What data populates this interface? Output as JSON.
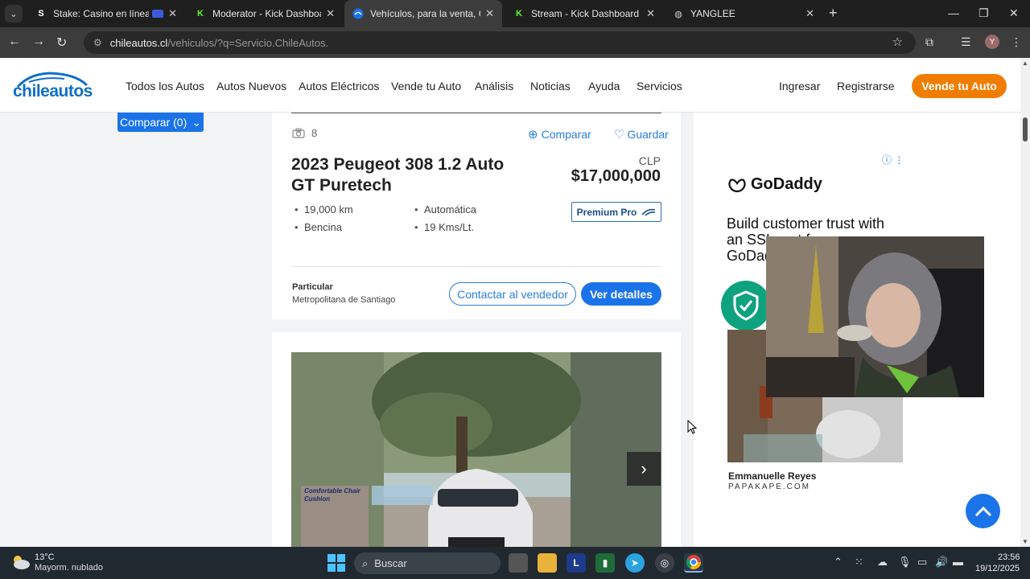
{
  "browser": {
    "tabs": [
      {
        "title": "Stake: Casino en línea y Ap",
        "favicon": "S"
      },
      {
        "title": "Moderator - Kick Dashboard",
        "favicon": "K"
      },
      {
        "title": "Vehículos, para la venta, Chile -",
        "favicon": "chileautos"
      },
      {
        "title": "Stream - Kick Dashboard",
        "favicon": "K"
      },
      {
        "title": "YANGLEE",
        "favicon": "globe"
      }
    ],
    "active_tab": 2,
    "url_host": "chileautos.cl",
    "url_path": "/vehiculos/?q=Servicio.ChileAutos.",
    "profile_initial": "Y"
  },
  "site": {
    "logo_text": "chileautos",
    "nav": [
      "Todos los Autos",
      "Autos Nuevos",
      "Autos Eléctricos",
      "Vende tu Auto",
      "Análisis",
      "Noticias",
      "Ayuda",
      "Servicios"
    ],
    "login": "Ingresar",
    "register": "Registrarse",
    "sell_button": "Vende tu Auto",
    "brand_color": "#0f6fc6",
    "accent_color": "#f07d00"
  },
  "compare_button": "Comparar (0)",
  "listing": {
    "photo_count": "8",
    "compare_label": "Comparar",
    "save_label": "Guardar",
    "title": "2023 Peugeot 308 1.2 Auto GT Puretech",
    "currency": "CLP",
    "price": "$17,000,000",
    "specs": [
      "19,000 km",
      "Automática",
      "Bencina",
      "19 Kms/Lt."
    ],
    "badge": "Premium Pro",
    "seller_type": "Particular",
    "seller_location": "Metropolitana de Santiago",
    "contact_button": "Contactar al vendedor",
    "details_button": "Ver detalles"
  },
  "ad": {
    "brand": "GoDaddy",
    "headline": "Build customer trust with an SSL cert from GoDaddy"
  },
  "overlay": {
    "streamer_name": "Emmanuelle Reyes",
    "streamer_site": "PAPAKAPE.COM",
    "chair_caption": "Comfortable Chair Cushion"
  },
  "taskbar": {
    "temperature": "13°C",
    "weather": "Mayorm. nublado",
    "search_placeholder": "Buscar",
    "time": "23:56",
    "date": "19/12/2025"
  }
}
